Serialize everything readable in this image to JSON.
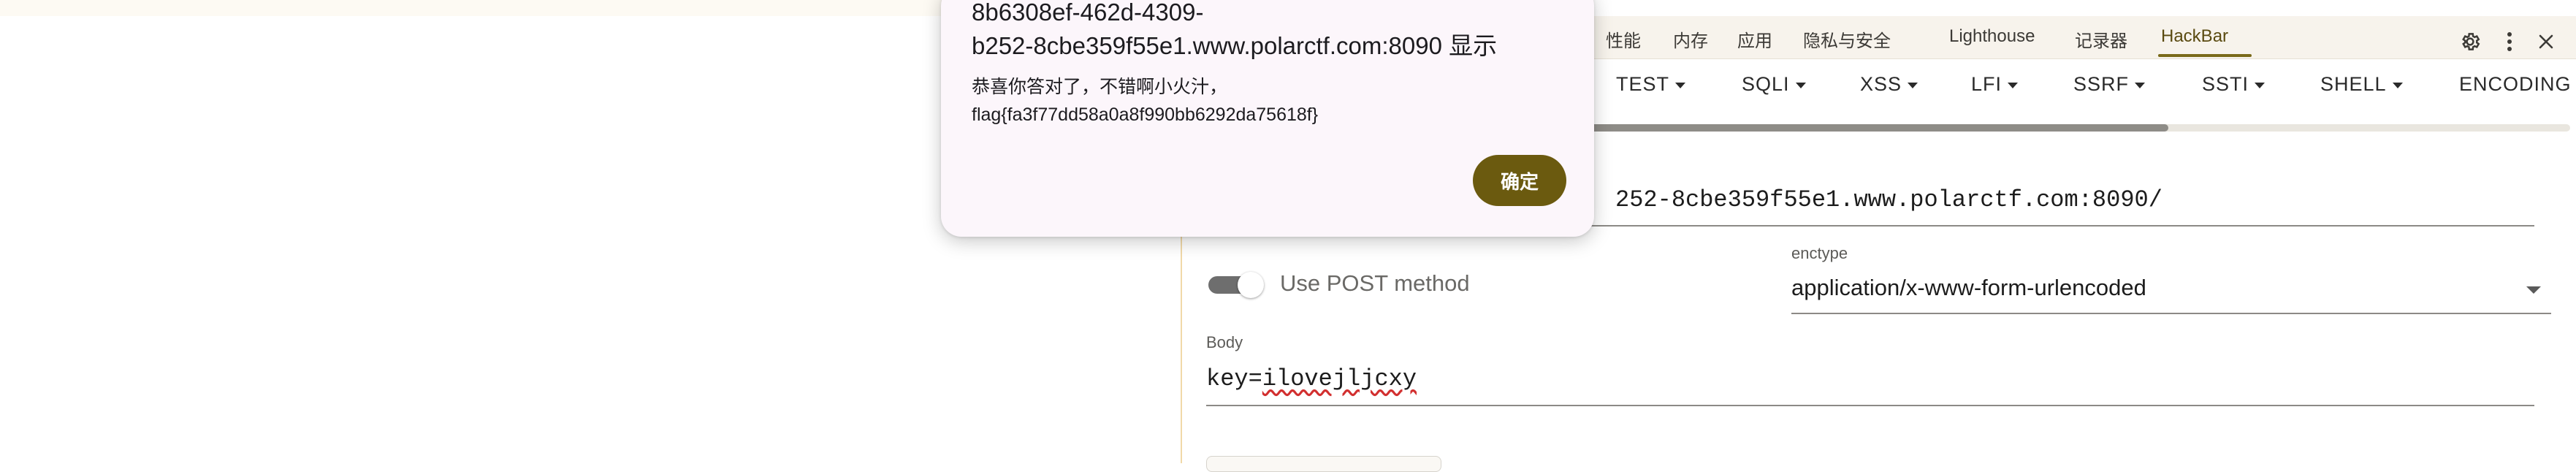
{
  "devtools": {
    "tabs": [
      {
        "label": "性能"
      },
      {
        "label": "内存"
      },
      {
        "label": "应用"
      },
      {
        "label": "隐私与安全"
      },
      {
        "label": "Lighthouse"
      },
      {
        "label": "记录器"
      },
      {
        "label": "HackBar"
      }
    ],
    "active_tab": "HackBar",
    "icons": [
      "gear-icon",
      "more-vert-icon",
      "close-icon"
    ]
  },
  "hackbar": {
    "menus": [
      {
        "label": "TEST"
      },
      {
        "label": "SQLI"
      },
      {
        "label": "XSS"
      },
      {
        "label": "LFI"
      },
      {
        "label": "SSRF"
      },
      {
        "label": "SSTI"
      },
      {
        "label": "SHELL"
      },
      {
        "label": "ENCODING"
      }
    ],
    "url_visible": "252-8cbe359f55e1.www.polarctf.com:8090/",
    "post_toggle_label": "Use POST method",
    "post_enabled": true,
    "enctype_label": "enctype",
    "enctype_value": "application/x-www-form-urlencoded",
    "body_label": "Body",
    "body_prefix": "key=",
    "body_value": "ilovejljcxy"
  },
  "dialog": {
    "title_line1": "8b6308ef-462d-4309-",
    "title_line2": "b252-8cbe359f55e1.www.polarctf.com:8090 显示",
    "message_line1": "恭喜你答对了，不错啊小火汁，",
    "message_line2": "flag{fa3f77dd58a0a8f990bb6292da75618f}",
    "ok_label": "确定"
  },
  "colors": {
    "accent": "#6b5a0f",
    "dialog_bg": "#fcf6fb",
    "tab_underline": "#7a6a1a"
  }
}
